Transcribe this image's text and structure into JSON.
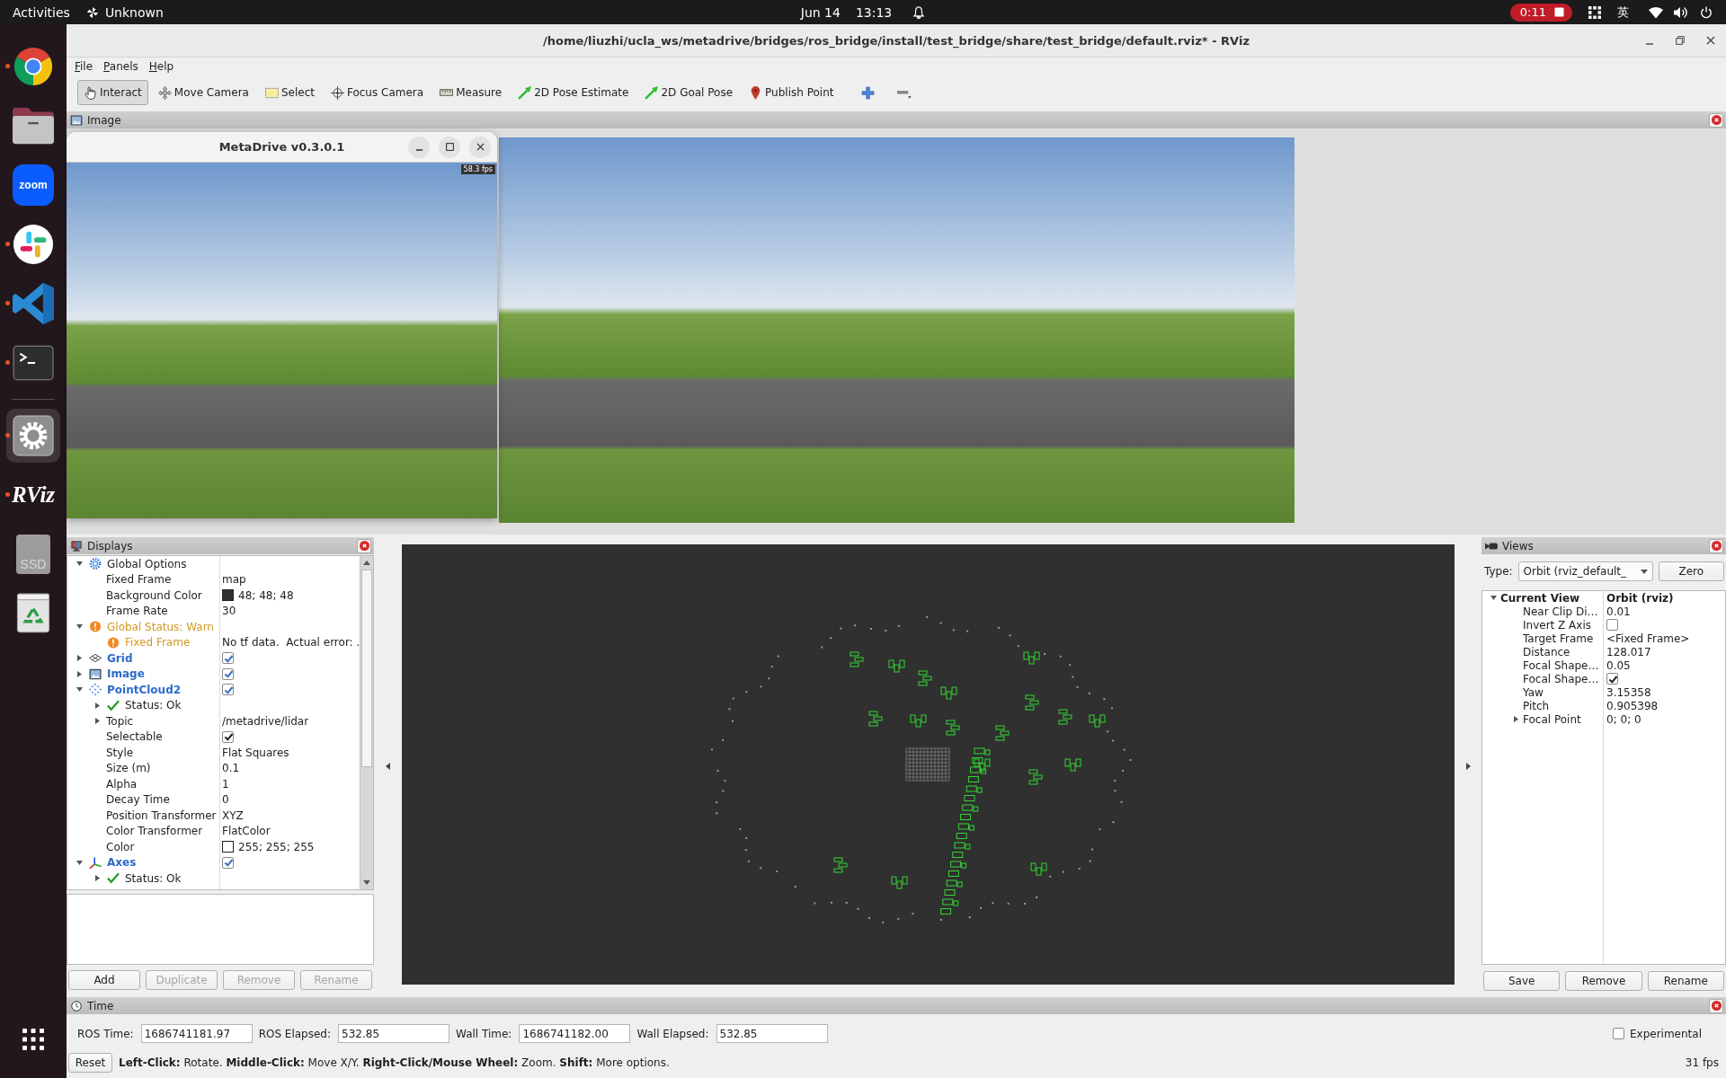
{
  "top_bar": {
    "activities": "Activities",
    "app_menu": "Unknown",
    "date": "Jun 14",
    "time": "13:13",
    "recording": "0:11",
    "input_method": "英"
  },
  "dock": {
    "apps": [
      {
        "running": true,
        "selected": false
      },
      {
        "running": false,
        "selected": false
      },
      {
        "label": "zoom",
        "running": false,
        "selected": false
      },
      {
        "running": true,
        "selected": false
      },
      {
        "running": true,
        "selected": false
      },
      {
        "running": true,
        "selected": false
      }
    ],
    "others": [
      {
        "running": true,
        "selected": true
      },
      {
        "label": "RViz",
        "running": true,
        "selected": false
      },
      {
        "label": "SSD",
        "running": false,
        "selected": false
      },
      {
        "running": false,
        "selected": false
      }
    ]
  },
  "window": {
    "title": "/home/liuzhi/ucla_ws/metadrive/bridges/ros_bridge/install/test_bridge/share/test_bridge/default.rviz* - RViz",
    "menu": [
      "File",
      "Panels",
      "Help"
    ]
  },
  "toolbar": {
    "tools": [
      {
        "label": "Interact",
        "selected": true
      },
      {
        "label": "Move Camera",
        "selected": false
      },
      {
        "label": "Select",
        "selected": false
      },
      {
        "label": "Focus Camera",
        "selected": false
      },
      {
        "label": "Measure",
        "selected": false
      },
      {
        "label": "2D Pose Estimate",
        "selected": false
      },
      {
        "label": "2D Goal Pose",
        "selected": false
      },
      {
        "label": "Publish Point",
        "selected": false
      }
    ]
  },
  "image_panel": {
    "title": "Image"
  },
  "metadrive_window": {
    "title": "MetaDrive v0.3.0.1",
    "fps": "58.3 fps"
  },
  "displays_panel": {
    "title": "Displays",
    "items": [
      {
        "kind": "group",
        "label": "Global Options",
        "expanded": true,
        "children": [
          {
            "kind": "property",
            "label": "Fixed Frame",
            "value": "map"
          },
          {
            "kind": "color",
            "label": "Background Color",
            "value": "48; 48; 48",
            "color": "#303030"
          },
          {
            "kind": "property",
            "label": "Frame Rate",
            "value": "30"
          }
        ]
      },
      {
        "kind": "status",
        "label": "Global Status: Warn",
        "warn": true,
        "expanded": true,
        "children": [
          {
            "kind": "status",
            "label": "Fixed Frame",
            "warn": true,
            "value": "No tf data.  Actual error: ."
          }
        ]
      },
      {
        "kind": "display",
        "label": "Grid",
        "expanded": false,
        "checked": true
      },
      {
        "kind": "display",
        "label": "Image",
        "expanded": false,
        "checked": true
      },
      {
        "kind": "display",
        "label": "PointCloud2",
        "expanded": true,
        "checked": true,
        "children": [
          {
            "kind": "status",
            "label": "Status: Ok",
            "warn": false,
            "expanded": false
          },
          {
            "kind": "property",
            "label": "Topic",
            "value": "/metadrive/lidar",
            "expanded": false
          },
          {
            "kind": "checkbox",
            "label": "Selectable",
            "checked": true
          },
          {
            "kind": "property",
            "label": "Style",
            "value": "Flat Squares"
          },
          {
            "kind": "property",
            "label": "Size (m)",
            "value": "0.1"
          },
          {
            "kind": "property",
            "label": "Alpha",
            "value": "1"
          },
          {
            "kind": "property",
            "label": "Decay Time",
            "value": "0"
          },
          {
            "kind": "property",
            "label": "Position Transformer",
            "value": "XYZ"
          },
          {
            "kind": "property",
            "label": "Color Transformer",
            "value": "FlatColor"
          },
          {
            "kind": "color",
            "label": "Color",
            "value": "255; 255; 255",
            "color": "#ffffff"
          }
        ]
      },
      {
        "kind": "display",
        "label": "Axes",
        "expanded": true,
        "checked": true,
        "children": [
          {
            "kind": "status",
            "label": "Status: Ok",
            "warn": false,
            "expanded": false
          }
        ]
      }
    ],
    "buttons": [
      {
        "label": "Add",
        "disabled": false
      },
      {
        "label": "Duplicate",
        "disabled": true
      },
      {
        "label": "Remove",
        "disabled": true
      },
      {
        "label": "Rename",
        "disabled": true
      }
    ]
  },
  "views_panel": {
    "title": "Views",
    "type_label": "Type:",
    "type_value": "Orbit (rviz_default_",
    "zero_button": "Zero",
    "items": [
      {
        "kind": "group",
        "label": "Current View",
        "value": "Orbit (rviz)",
        "expanded": true,
        "children": [
          {
            "kind": "property",
            "label": "Near Clip Di…",
            "value": "0.01"
          },
          {
            "kind": "checkbox",
            "label": "Invert Z Axis",
            "checked": false
          },
          {
            "kind": "property",
            "label": "Target Frame",
            "value": "<Fixed Frame>"
          },
          {
            "kind": "property",
            "label": "Distance",
            "value": "128.017"
          },
          {
            "kind": "property",
            "label": "Focal Shape…",
            "value": "0.05"
          },
          {
            "kind": "checkbox",
            "label": "Focal Shape…",
            "checked": true
          },
          {
            "kind": "property",
            "label": "Yaw",
            "value": "3.15358"
          },
          {
            "kind": "property",
            "label": "Pitch",
            "value": "0.905398"
          },
          {
            "kind": "property",
            "label": "Focal Point",
            "value": "0; 0; 0",
            "expanded": false
          }
        ]
      }
    ],
    "buttons": [
      "Save",
      "Remove",
      "Rename"
    ]
  },
  "time_panel": {
    "title": "Time",
    "fields": [
      {
        "label": "ROS Time:",
        "value": "1686741181.97"
      },
      {
        "label": "ROS Elapsed:",
        "value": "532.85"
      },
      {
        "label": "Wall Time:",
        "value": "1686741182.00"
      },
      {
        "label": "Wall Elapsed:",
        "value": "532.85"
      }
    ],
    "experimental": {
      "label": "Experimental",
      "checked": false
    },
    "reset_button": "Reset",
    "hint": "**Left-Click:** Rotate. **Middle-Click:** Move X/Y. **Right-Click/Mouse Wheel:** Zoom. **Shift:** More options.",
    "fps": "31 fps"
  }
}
